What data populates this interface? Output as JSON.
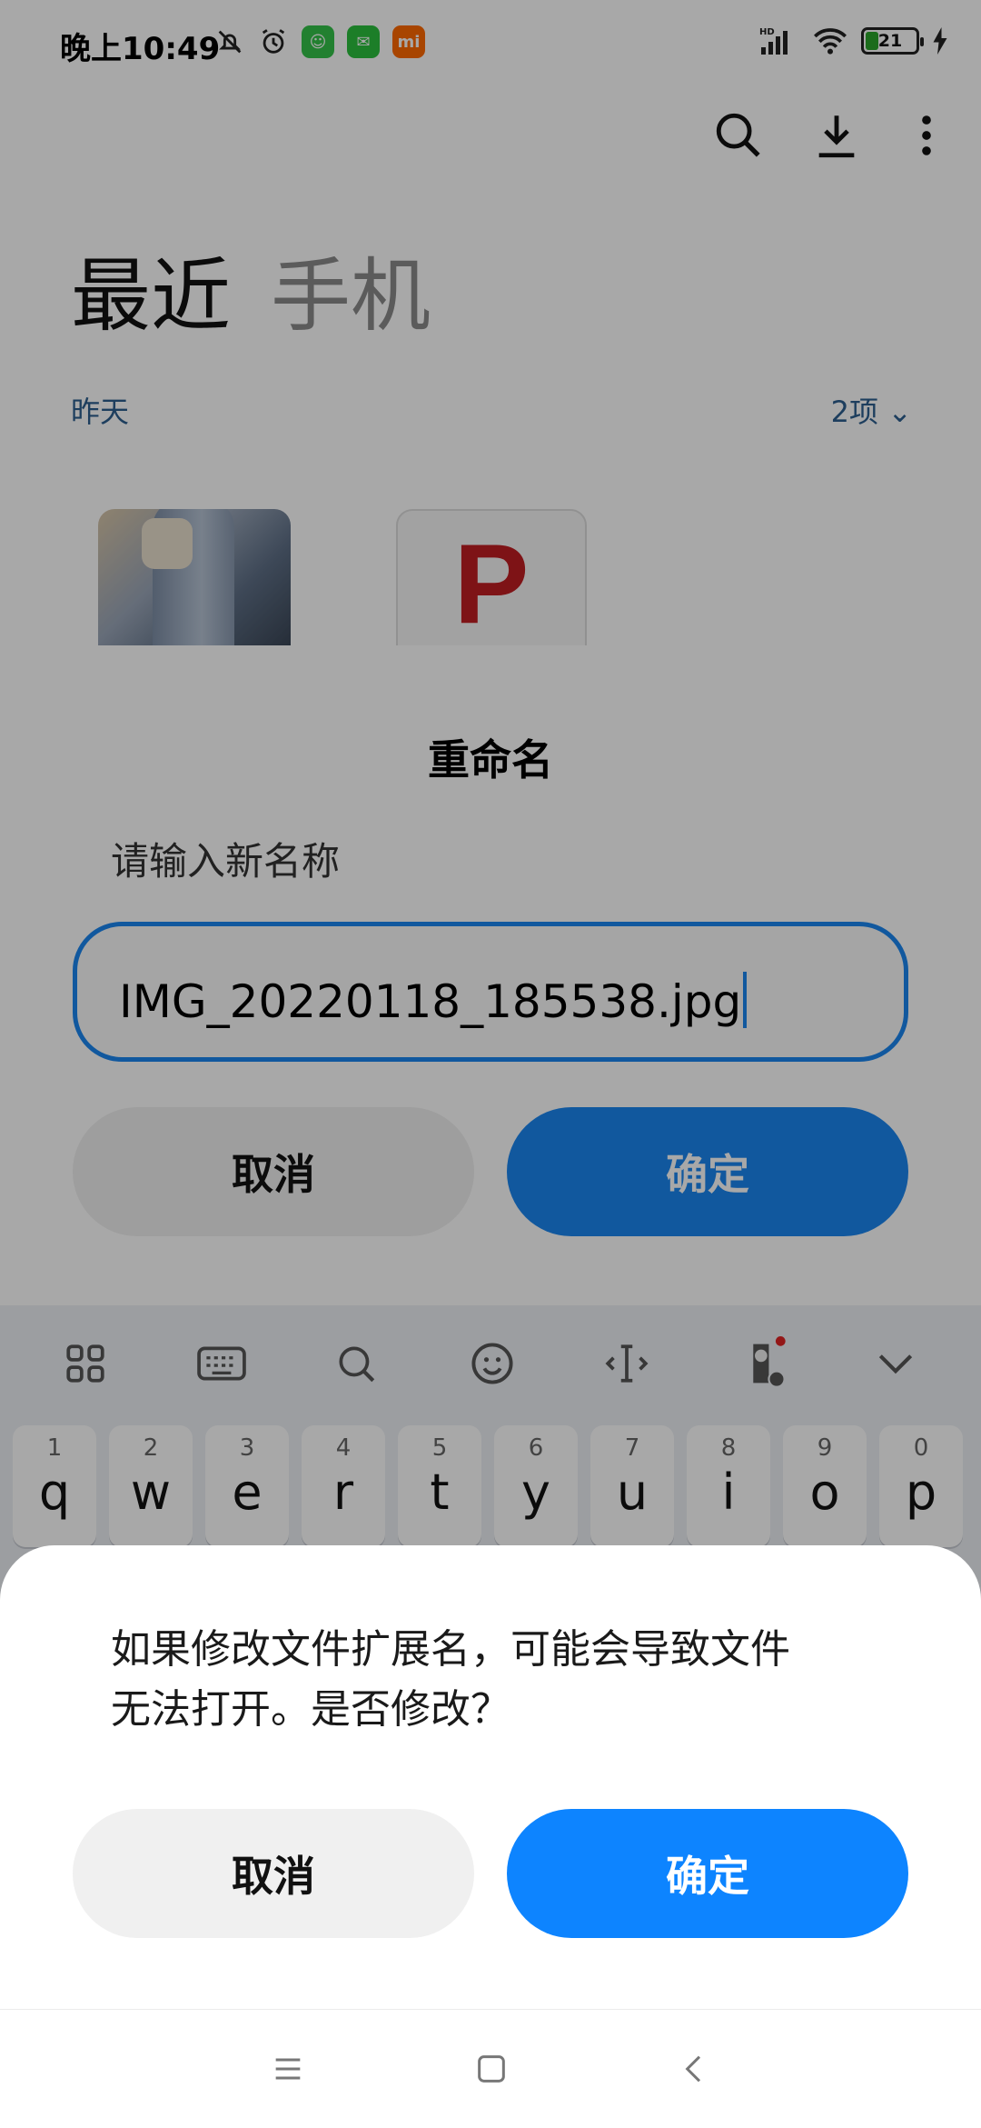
{
  "status_bar": {
    "time": "晚上10:49",
    "battery_level": "21",
    "signal_label": "HD"
  },
  "files_app": {
    "tabs": [
      "最近",
      "手机"
    ],
    "group_date": "昨天",
    "group_count": "2项",
    "thumb2_letter": "P",
    "toolbar_icons": [
      "search-icon",
      "download-icon",
      "more-icon"
    ]
  },
  "rename_dialog": {
    "title": "重命名",
    "prompt": "请输入新名称",
    "input_value": "IMG_20220118_185538.jpg",
    "cancel_label": "取消",
    "confirm_label": "确定"
  },
  "keyboard": {
    "toolbar_icons": [
      "grid-icon",
      "keyboard-icon",
      "search-icon",
      "emoji-icon",
      "cursor-icon",
      "voice-icon",
      "collapse-icon"
    ],
    "keys": [
      {
        "num": "1",
        "ch": "q"
      },
      {
        "num": "2",
        "ch": "w"
      },
      {
        "num": "3",
        "ch": "e"
      },
      {
        "num": "4",
        "ch": "r"
      },
      {
        "num": "5",
        "ch": "t"
      },
      {
        "num": "6",
        "ch": "y"
      },
      {
        "num": "7",
        "ch": "u"
      },
      {
        "num": "8",
        "ch": "i"
      },
      {
        "num": "9",
        "ch": "o"
      },
      {
        "num": "0",
        "ch": "p"
      }
    ]
  },
  "warning_sheet": {
    "message_line1": "如果修改文件扩展名，可能会导致文件",
    "message_line2": "无法打开。是否修改？",
    "cancel_label": "取消",
    "confirm_label": "确定"
  },
  "colors": {
    "accent": "#0d84ff",
    "dim_overlay": "#000000"
  }
}
